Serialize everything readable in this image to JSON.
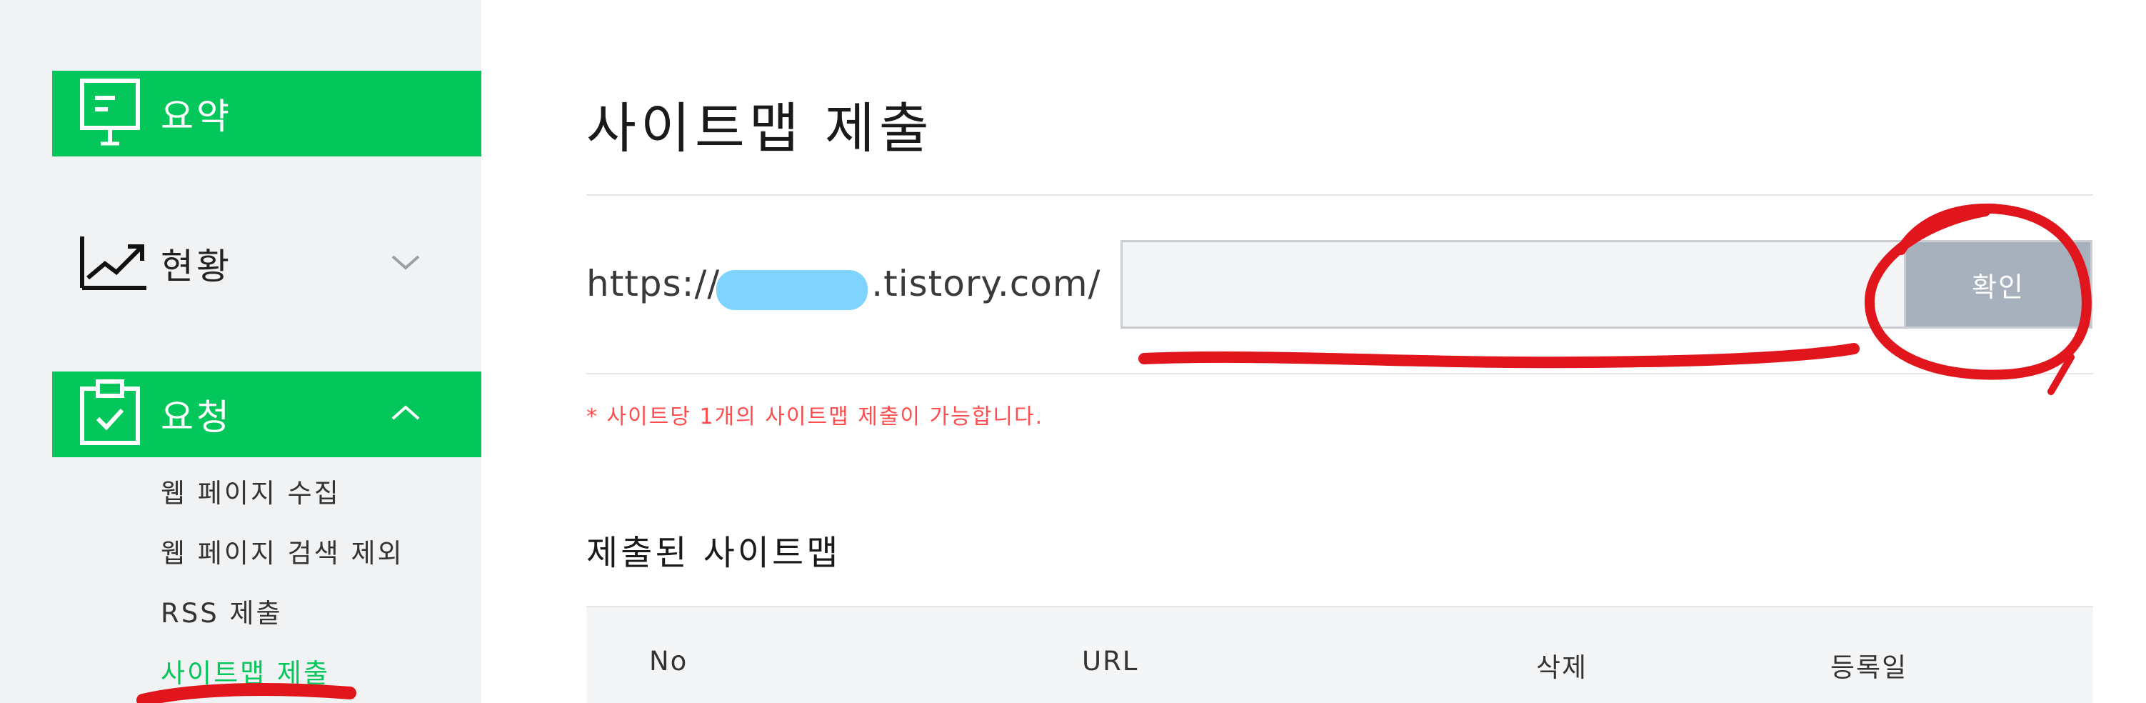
{
  "sidebar": {
    "items": [
      {
        "label": "요약",
        "icon": "presentation-board-icon",
        "active": true
      },
      {
        "label": "현황",
        "icon": "trend-chart-icon",
        "active": false,
        "expanded": false
      },
      {
        "label": "요청",
        "icon": "clipboard-check-icon",
        "active": true,
        "expanded": true
      }
    ],
    "sub_items": [
      {
        "label": "웹 페이지 수집"
      },
      {
        "label": "웹 페이지 검색 제외"
      },
      {
        "label": "RSS 제출"
      },
      {
        "label": "사이트맵 제출",
        "current": true
      }
    ]
  },
  "main": {
    "title": "사이트맵 제출",
    "url_prefix": "https://",
    "url_suffix": ".tistory.com/",
    "input_value": "",
    "confirm_label": "확인",
    "notice": "* 사이트당 1개의 사이트맵 제출이 가능합니다.",
    "submitted_title": "제출된 사이트맵",
    "table_headers": [
      "No",
      "URL",
      "삭제",
      "등록일"
    ]
  },
  "colors": {
    "accent": "#03c75a",
    "notice": "#ff4c4c",
    "button": "#a7b1bd",
    "redaction": "#7fd3ff",
    "annotation": "#e0161c"
  }
}
